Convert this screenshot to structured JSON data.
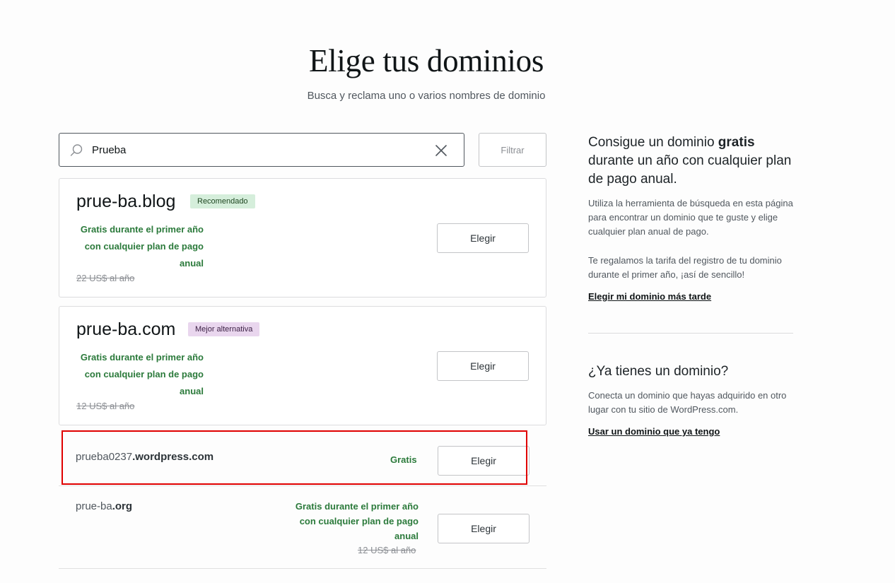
{
  "header": {
    "title": "Elige tus dominios",
    "subtitle": "Busca y reclama uno o varios nombres de dominio"
  },
  "search": {
    "value": "Prueba",
    "icon": "search-icon",
    "clear_icon": "close-icon",
    "filter_label": "Filtrar"
  },
  "featured": [
    {
      "domain": "prue-ba.blog",
      "badge": "Recomendado",
      "promo": "Gratis durante el primer año con cualquier plan de pago anual",
      "old_price": "22 US$ al año",
      "button": "Elegir"
    },
    {
      "domain": "prue-ba.com",
      "badge": "Mejor alternativa",
      "promo": "Gratis durante el primer año con cualquier plan de pago anual",
      "old_price": "12 US$ al año",
      "button": "Elegir"
    }
  ],
  "rows": [
    {
      "name": "prueba0237",
      "tld": ".wordpress.com",
      "price": "Gratis",
      "button": "Elegir"
    },
    {
      "name": "prue-ba",
      "tld": ".org",
      "promo": "Gratis durante el primer año con cualquier plan de pago anual",
      "old_price": "12 US$ al año",
      "button": "Elegir"
    }
  ],
  "sidebar": {
    "free_heading_pre": "Consigue un dominio ",
    "free_heading_bold": "gratis",
    "free_heading_post": " durante un año con cualquier plan de pago anual.",
    "free_text_1": "Utiliza la herramienta de búsqueda en esta página para encontrar un dominio que te guste y elige cualquier plan anual de pago.",
    "free_text_2": "Te regalamos la tarifa del registro de tu dominio durante el primer año, ¡así de sencillo!",
    "later_link": "Elegir mi dominio más tarde",
    "own_heading": "¿Ya tienes un dominio?",
    "own_text": "Conecta un dominio que hayas adquirido en otro lugar con tu sitio de WordPress.com.",
    "own_link": "Usar un dominio que ya tengo"
  },
  "colors": {
    "promo_green": "#2b7a3b",
    "badge_recommended": "#d5eedb",
    "badge_alternative": "#e9d6ee",
    "highlight_red": "#e00000"
  }
}
